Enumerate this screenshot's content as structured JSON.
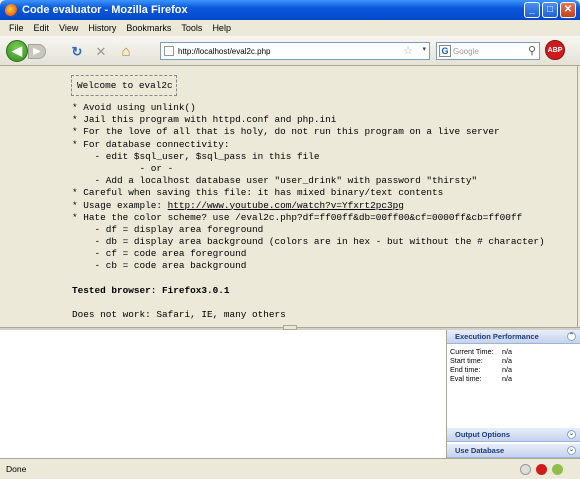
{
  "window": {
    "title": "Code evaluator - Mozilla Firefox",
    "buttons": {
      "minimize": "_",
      "maximize": "□",
      "close": "✕"
    }
  },
  "menu": [
    "File",
    "Edit",
    "View",
    "History",
    "Bookmarks",
    "Tools",
    "Help"
  ],
  "nav": {
    "url": "http://localhost/eval2c.php",
    "search_placeholder": "Google",
    "search_engine": "G",
    "adblock": "ABP",
    "back": "◀",
    "forward": "▶",
    "reload": "↻",
    "stop": "✕",
    "home": "⌂",
    "star": "☆",
    "dropdown": "▾",
    "search_icon": "⚲"
  },
  "page": {
    "welcome": "Welcome to eval2c",
    "lines": [
      "* Avoid using unlink()",
      "* Jail this program with httpd.conf and php.ini",
      "* For the love of all that is holy, do not run this program on a live server",
      "* For database connectivity:",
      "    - edit $sql_user, $sql_pass in this file",
      "            - or -",
      "    - Add a localhost database user \"user_drink\" with password \"thirsty\"",
      "* Careful when saving this file: it has mixed binary/text contents"
    ],
    "usage_prefix": "* Usage example: ",
    "usage_link": "http://www.youtube.com/watch?v=Yfxrt2pc3pg",
    "lines2": [
      "* Hate the color scheme? use /eval2c.php?df=ff00ff&db=00ff00&cf=0000ff&cb=ff00ff",
      "    - df = display area foreground",
      "    - db = display area background (colors are in hex - but without the # character)",
      "    - cf = code area foreground",
      "    - cb = code area background"
    ],
    "tested": "Tested browser: Firefox3.0.1",
    "not_work": "Does not work: Safari, IE, many others"
  },
  "side": {
    "exec_title": "Execution Performance",
    "rows": [
      {
        "k": "Current Time:",
        "v": "n/a"
      },
      {
        "k": "Start time:",
        "v": "n/a"
      },
      {
        "k": "End time:",
        "v": "n/a"
      },
      {
        "k": "Eval time:",
        "v": "n/a"
      }
    ],
    "output_title": "Output Options",
    "db_title": "Use Database",
    "collapse": "⌃",
    "expand": "⌄"
  },
  "status": {
    "text": "Done"
  },
  "colors": {
    "title_blue": "#0a58dc",
    "panel_header": "#c4d3ee"
  }
}
